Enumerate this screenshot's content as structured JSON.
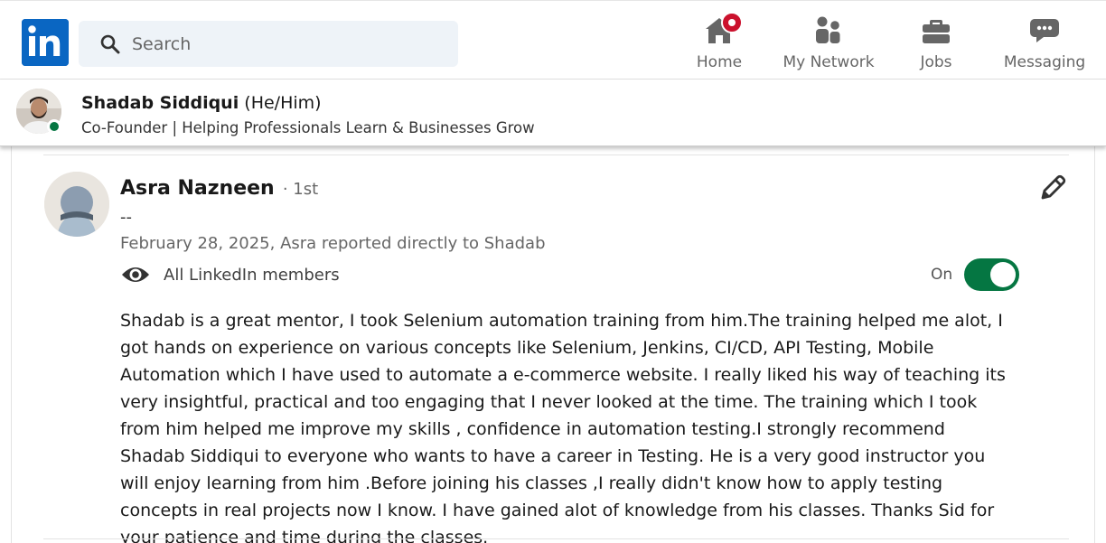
{
  "nav": {
    "logo_text": "in",
    "search": {
      "placeholder": "Search"
    },
    "items": [
      {
        "label": "Home",
        "icon": "home-icon",
        "has_notification": true
      },
      {
        "label": "My Network",
        "icon": "people-icon"
      },
      {
        "label": "Jobs",
        "icon": "briefcase-icon"
      },
      {
        "label": "Messaging",
        "icon": "message-icon"
      }
    ]
  },
  "profile": {
    "name": "Shadab Siddiqui",
    "pronouns": "(He/Him)",
    "headline": "Co-Founder | Helping Professionals Learn & Businesses Grow",
    "online": true
  },
  "recommendation": {
    "recommender_name": "Asra Nazneen",
    "degree": "· 1st",
    "recommender_headline": "--",
    "meta": "February 28, 2025, Asra reported directly to Shadab",
    "visibility_label": "All LinkedIn members",
    "toggle_label": "On",
    "toggle_on": true,
    "body": "Shadab is a great mentor, I took Selenium automation training from him.The training helped me alot, I got hands on experience on various concepts like Selenium, Jenkins, CI/CD, API Testing, Mobile Automation which I have used to automate a e-commerce website. I really liked his way of teaching its very insightful, practical and too engaging that I never looked at the time. The training which I took from him helped me improve my skills , confidence in automation testing.I strongly recommend Shadab Siddiqui to everyone who wants to have a career in Testing. He is a very good instructor you will enjoy learning from him .Before joining his classes ,I really didn't know how to apply testing concepts in real projects now I know. I have gained alot of knowledge from his classes. Thanks Sid for your patience and time during the classes."
  },
  "colors": {
    "brand": "#0a66c2",
    "notification": "#cb112d",
    "toggle_on": "#057642",
    "online": "#057642"
  }
}
